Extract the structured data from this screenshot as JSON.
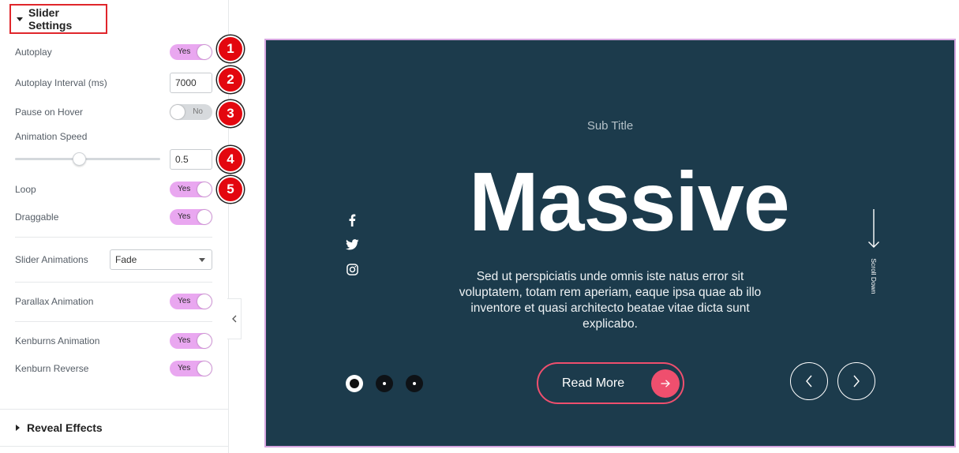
{
  "panel": {
    "slider_settings": "Slider Settings",
    "autoplay": {
      "label": "Autoplay",
      "state": "Yes"
    },
    "autoplay_interval": {
      "label": "Autoplay Interval (ms)",
      "value": "7000"
    },
    "pause_on_hover": {
      "label": "Pause on Hover",
      "state": "No"
    },
    "animation_speed": {
      "label": "Animation Speed",
      "value": "0.5"
    },
    "loop": {
      "label": "Loop",
      "state": "Yes"
    },
    "draggable": {
      "label": "Draggable",
      "state": "Yes"
    },
    "slider_animations": {
      "label": "Slider Animations",
      "selected": "Fade"
    },
    "parallax_animation": {
      "label": "Parallax Animation",
      "state": "Yes"
    },
    "kenburns_animation": {
      "label": "Kenburns Animation",
      "state": "Yes"
    },
    "kenburn_reverse": {
      "label": "Kenburn Reverse",
      "state": "Yes"
    },
    "reveal_effects": "Reveal Effects",
    "badges": [
      "1",
      "2",
      "3",
      "4",
      "5"
    ]
  },
  "preview": {
    "subtitle": "Sub Title",
    "headline": "Massive",
    "body": "Sed ut perspiciatis unde omnis iste natus error sit voluptatem, totam rem aperiam, eaque ipsa quae ab illo inventore et quasi architecto beatae vitae dicta sunt explicabo.",
    "scroll_down": "Scroll Down",
    "read_more": "Read More",
    "social_icons": [
      "facebook-icon",
      "twitter-icon",
      "instagram-icon"
    ],
    "pagination": {
      "count": 3,
      "active_index": 0
    }
  },
  "colors": {
    "slide_background": "#1c3b4c",
    "accent": "#ef4f6e",
    "toggle_on": "#e9a7f0",
    "badge": "#e3070f",
    "frame_border": "#d6a5e0"
  }
}
